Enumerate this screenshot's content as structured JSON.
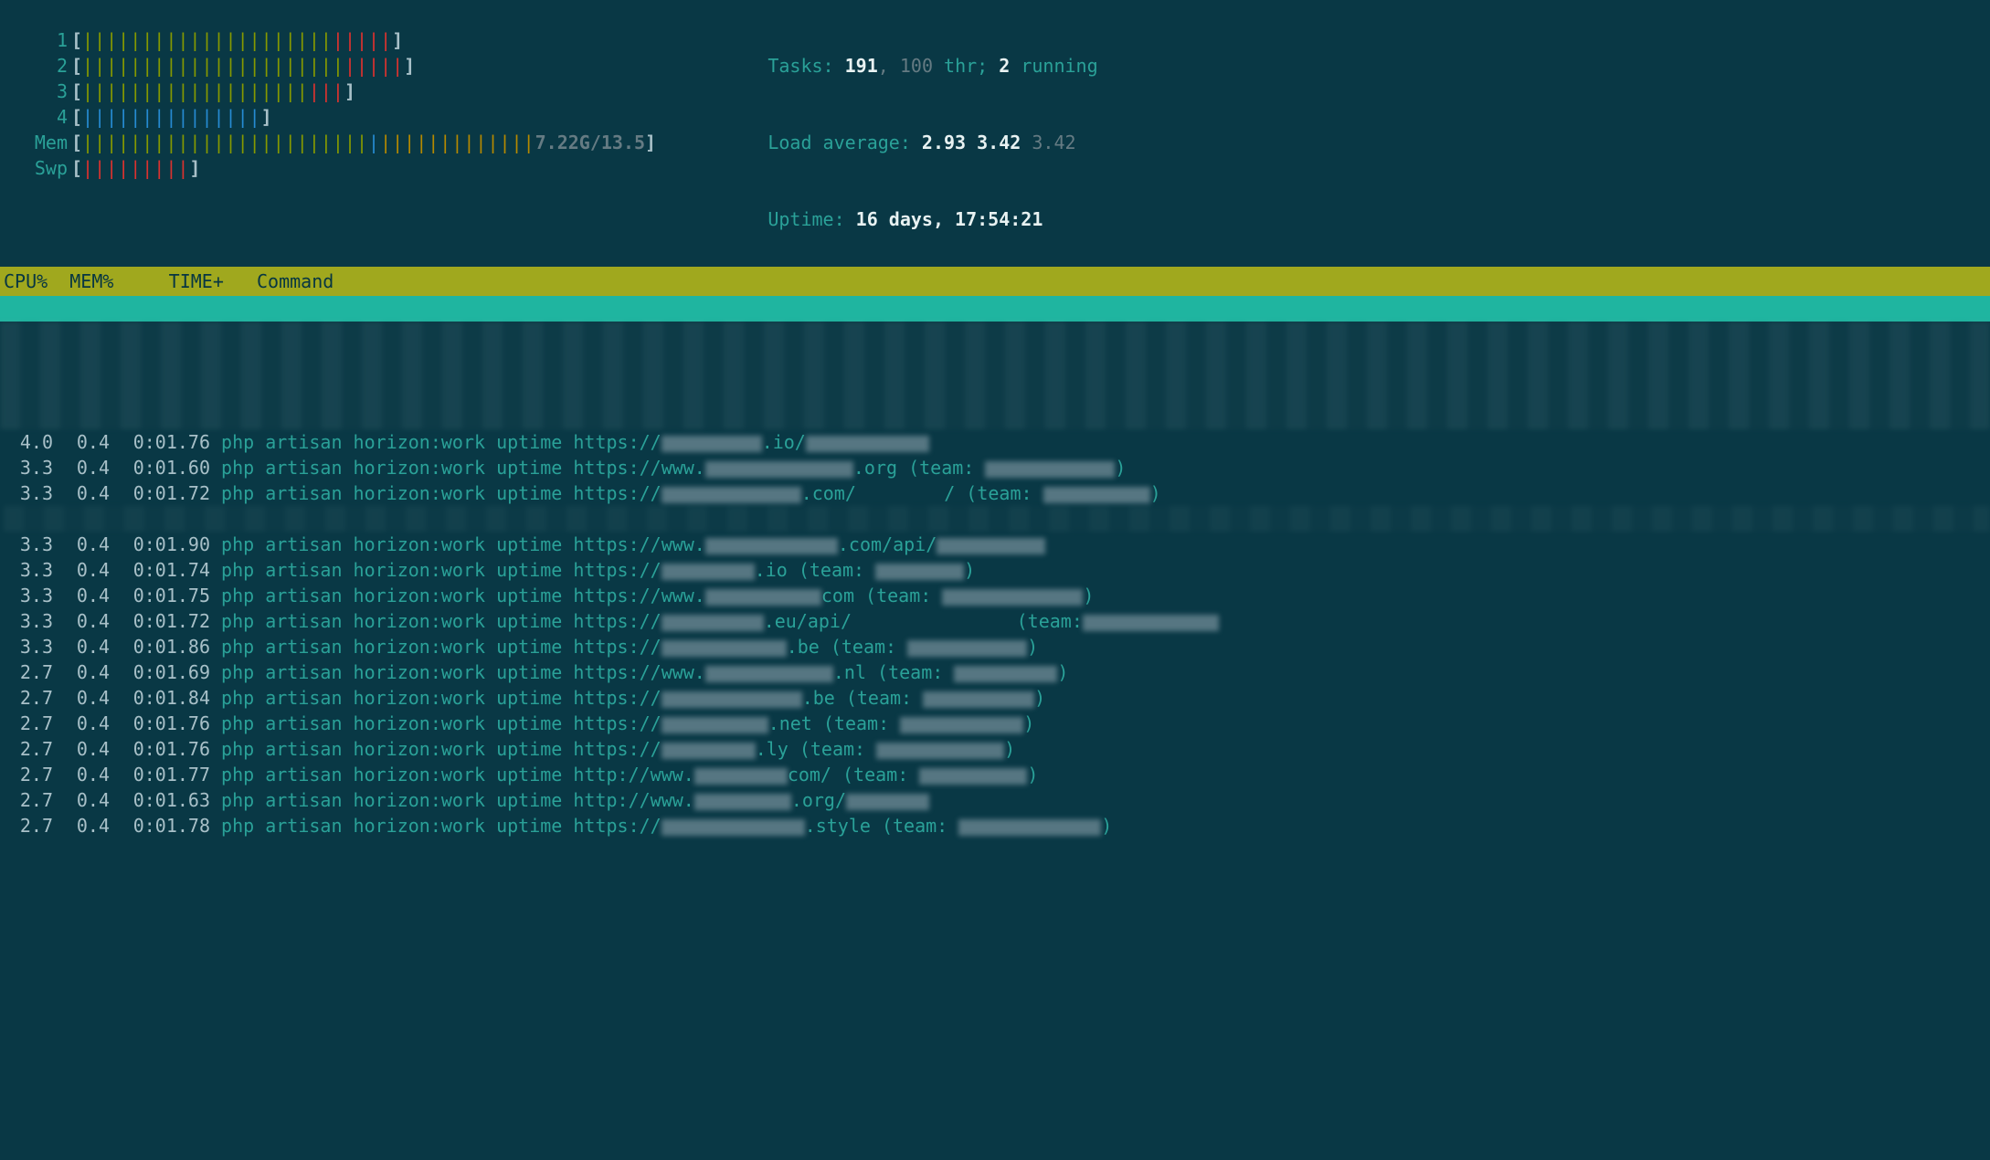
{
  "cpu_meters": [
    {
      "label": "1",
      "green": 21,
      "red": 5
    },
    {
      "label": "2",
      "green": 22,
      "red": 5
    },
    {
      "label": "3",
      "green": 19,
      "red": 3
    },
    {
      "label": "4",
      "blue": 15,
      "underline_blue": 8
    }
  ],
  "mem": {
    "label": "Mem",
    "green": 24,
    "blue": 1,
    "yellow": 13,
    "text": "7.22G/13.5"
  },
  "swap": {
    "label": "Swp",
    "red": 9
  },
  "tasks": {
    "label": "Tasks: ",
    "total": "191",
    "sep1": ", ",
    "thr": "100",
    "thr_label": " thr; ",
    "running": "2",
    "running_label": " running"
  },
  "load": {
    "label": "Load average: ",
    "v1": "2.93",
    "v2": "3.42",
    "v3": "3.42"
  },
  "uptime": {
    "label": "Uptime: ",
    "value": "16 days, 17:54:21"
  },
  "columns": {
    "cpu": "CPU%",
    "mem": "MEM%",
    "time": "TIME+",
    "cmd": "Command"
  },
  "cmd_prefix": "php artisan horizon:work uptime ",
  "processes": [
    {
      "cpu": "4.0",
      "mem": "0.4",
      "time": "0:01.76",
      "url_pre": "https://",
      "url_post": ".io/",
      "extra": ""
    },
    {
      "cpu": "3.3",
      "mem": "0.4",
      "time": "0:01.60",
      "url_pre": "https://www.",
      "url_post": ".org (team: ",
      "extra": ")"
    },
    {
      "cpu": "3.3",
      "mem": "0.4",
      "time": "0:01.72",
      "url_pre": "https://",
      "url_post": ".com/        / (team: ",
      "extra": ")"
    },
    {
      "blurred": true
    },
    {
      "cpu": "3.3",
      "mem": "0.4",
      "time": "0:01.90",
      "url_pre": "https://www.",
      "url_post": ".com/api/",
      "extra": ""
    },
    {
      "cpu": "3.3",
      "mem": "0.4",
      "time": "0:01.74",
      "url_pre": "https://",
      "url_post": ".io (team: ",
      "extra": ")"
    },
    {
      "cpu": "3.3",
      "mem": "0.4",
      "time": "0:01.75",
      "url_pre": "https://www.",
      "url_post": "com (team: ",
      "extra": ")"
    },
    {
      "cpu": "3.3",
      "mem": "0.4",
      "time": "0:01.72",
      "url_pre": "https://",
      "url_post": ".eu/api/               (team:",
      "extra": ""
    },
    {
      "cpu": "3.3",
      "mem": "0.4",
      "time": "0:01.86",
      "url_pre": "https://",
      "url_post": ".be (team: ",
      "extra": ")"
    },
    {
      "cpu": "2.7",
      "mem": "0.4",
      "time": "0:01.69",
      "url_pre": "https://www.",
      "url_post": ".nl (team: ",
      "extra": ")"
    },
    {
      "cpu": "2.7",
      "mem": "0.4",
      "time": "0:01.84",
      "url_pre": "https://",
      "url_post": ".be (team: ",
      "extra": ")"
    },
    {
      "cpu": "2.7",
      "mem": "0.4",
      "time": "0:01.76",
      "url_pre": "https://",
      "url_post": ".net (team: ",
      "extra": ")"
    },
    {
      "cpu": "2.7",
      "mem": "0.4",
      "time": "0:01.76",
      "url_pre": "https://",
      "url_post": ".ly (team: ",
      "extra": ")"
    },
    {
      "cpu": "2.7",
      "mem": "0.4",
      "time": "0:01.77",
      "url_pre": "http://www.",
      "url_post": "com/ (team: ",
      "extra": ")"
    },
    {
      "cpu": "2.7",
      "mem": "0.4",
      "time": "0:01.63",
      "url_pre": "http://www.",
      "url_post": ".org/",
      "extra": ""
    },
    {
      "cpu": "2.7",
      "mem": "0.4",
      "time": "0:01.78",
      "url_pre": "https://",
      "url_post": ".style (team: ",
      "extra": ")"
    }
  ]
}
